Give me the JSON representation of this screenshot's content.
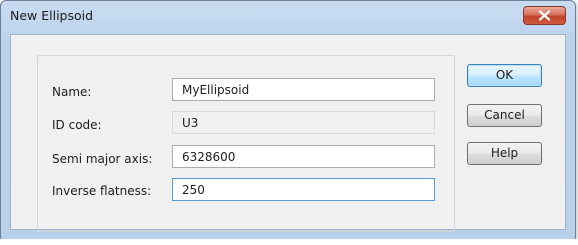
{
  "window": {
    "title": "New Ellipsoid"
  },
  "form": {
    "name": {
      "label": "Name:",
      "value": "MyEllipsoid"
    },
    "id_code": {
      "label": "ID code:",
      "value": "U3"
    },
    "semi_major_axis": {
      "label": "Semi major axis:",
      "value": "6328600"
    },
    "inverse_flattening": {
      "label": "Inverse flatness:",
      "value": "250"
    }
  },
  "buttons": {
    "ok": "OK",
    "cancel": "Cancel",
    "help": "Help"
  },
  "icons": {
    "close": "close-icon"
  },
  "colors": {
    "title_bar": "#c9dcf1",
    "close_button": "#c2412b",
    "dialog_body": "#f0f0f0",
    "default_button_border": "#3c7fb1"
  }
}
